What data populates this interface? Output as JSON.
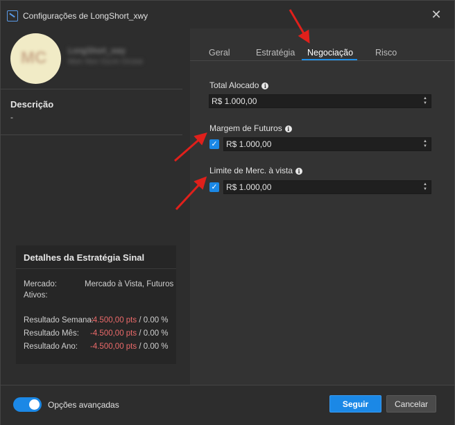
{
  "window": {
    "title": "Configurações de LongShort_xwy"
  },
  "profile": {
    "avatar_initials": "MC",
    "name_blurred": "LongShort_xwy",
    "subtitle_blurred": "Mon Nov 01cm Ocsse"
  },
  "description": {
    "title": "Descrição",
    "value": "-"
  },
  "details": {
    "title": "Detalhes da Estratégia Sinal",
    "mercado_label": "Mercado:",
    "mercado_value": "Mercado à Vista, Futuros",
    "ativos_label": "Ativos:",
    "rows": [
      {
        "label": "Resultado Semana:",
        "pts": "-4.500,00 pts",
        "pct": " / 0.00 %"
      },
      {
        "label": "Resultado Mês:",
        "pts": "-4.500,00 pts",
        "pct": " / 0.00 %"
      },
      {
        "label": "Resultado Ano:",
        "pts": "-4.500,00 pts",
        "pct": " / 0.00 %"
      }
    ]
  },
  "tabs": [
    {
      "label": "Geral",
      "active": false
    },
    {
      "label": "Estratégia",
      "active": false
    },
    {
      "label": "Negociação",
      "active": true
    },
    {
      "label": "Risco",
      "active": false
    }
  ],
  "fields": {
    "total_alocado": {
      "label": "Total Alocado",
      "value": "R$ 1.000,00"
    },
    "margem_futuros": {
      "label": "Margem de Futuros",
      "value": "R$ 1.000,00",
      "checked": true
    },
    "limite_merc": {
      "label": "Limite de Merc. à vista",
      "value": "R$ 1.000,00",
      "checked": true
    }
  },
  "footer": {
    "advanced_label": "Opções avançadas",
    "advanced_enabled": true,
    "primary_button": "Seguir",
    "cancel_button": "Cancelar"
  },
  "colors": {
    "accent": "#1b88e6",
    "negative": "#ec6a6a",
    "annotation_arrow": "#e0201b"
  },
  "icons": {
    "close": "close-icon",
    "info": "info-icon",
    "check": "check-icon",
    "app": "app-logo-icon"
  }
}
